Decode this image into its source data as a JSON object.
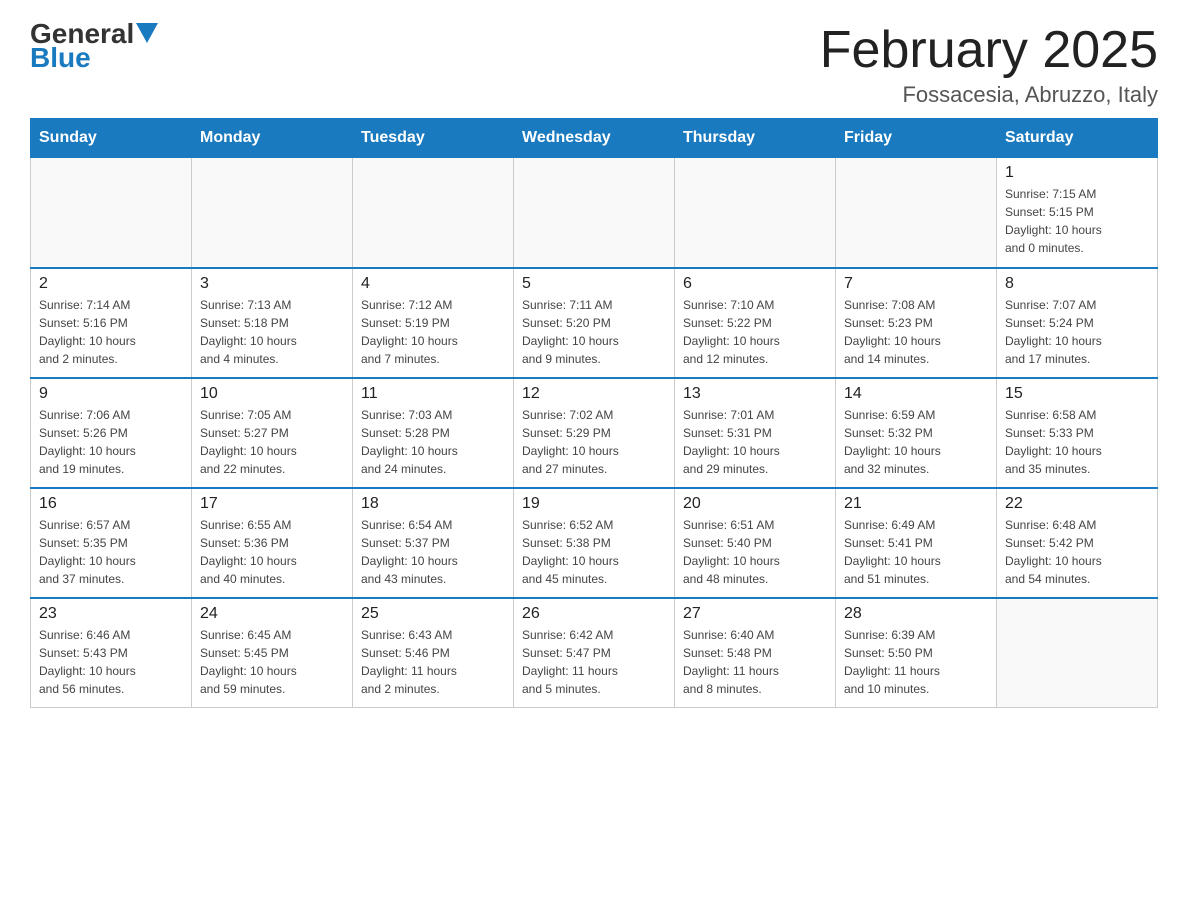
{
  "header": {
    "logo": {
      "general": "General",
      "blue": "Blue"
    },
    "title": "February 2025",
    "location": "Fossacesia, Abruzzo, Italy"
  },
  "days_of_week": [
    "Sunday",
    "Monday",
    "Tuesday",
    "Wednesday",
    "Thursday",
    "Friday",
    "Saturday"
  ],
  "weeks": [
    [
      {
        "day": "",
        "info": ""
      },
      {
        "day": "",
        "info": ""
      },
      {
        "day": "",
        "info": ""
      },
      {
        "day": "",
        "info": ""
      },
      {
        "day": "",
        "info": ""
      },
      {
        "day": "",
        "info": ""
      },
      {
        "day": "1",
        "info": "Sunrise: 7:15 AM\nSunset: 5:15 PM\nDaylight: 10 hours\nand 0 minutes."
      }
    ],
    [
      {
        "day": "2",
        "info": "Sunrise: 7:14 AM\nSunset: 5:16 PM\nDaylight: 10 hours\nand 2 minutes."
      },
      {
        "day": "3",
        "info": "Sunrise: 7:13 AM\nSunset: 5:18 PM\nDaylight: 10 hours\nand 4 minutes."
      },
      {
        "day": "4",
        "info": "Sunrise: 7:12 AM\nSunset: 5:19 PM\nDaylight: 10 hours\nand 7 minutes."
      },
      {
        "day": "5",
        "info": "Sunrise: 7:11 AM\nSunset: 5:20 PM\nDaylight: 10 hours\nand 9 minutes."
      },
      {
        "day": "6",
        "info": "Sunrise: 7:10 AM\nSunset: 5:22 PM\nDaylight: 10 hours\nand 12 minutes."
      },
      {
        "day": "7",
        "info": "Sunrise: 7:08 AM\nSunset: 5:23 PM\nDaylight: 10 hours\nand 14 minutes."
      },
      {
        "day": "8",
        "info": "Sunrise: 7:07 AM\nSunset: 5:24 PM\nDaylight: 10 hours\nand 17 minutes."
      }
    ],
    [
      {
        "day": "9",
        "info": "Sunrise: 7:06 AM\nSunset: 5:26 PM\nDaylight: 10 hours\nand 19 minutes."
      },
      {
        "day": "10",
        "info": "Sunrise: 7:05 AM\nSunset: 5:27 PM\nDaylight: 10 hours\nand 22 minutes."
      },
      {
        "day": "11",
        "info": "Sunrise: 7:03 AM\nSunset: 5:28 PM\nDaylight: 10 hours\nand 24 minutes."
      },
      {
        "day": "12",
        "info": "Sunrise: 7:02 AM\nSunset: 5:29 PM\nDaylight: 10 hours\nand 27 minutes."
      },
      {
        "day": "13",
        "info": "Sunrise: 7:01 AM\nSunset: 5:31 PM\nDaylight: 10 hours\nand 29 minutes."
      },
      {
        "day": "14",
        "info": "Sunrise: 6:59 AM\nSunset: 5:32 PM\nDaylight: 10 hours\nand 32 minutes."
      },
      {
        "day": "15",
        "info": "Sunrise: 6:58 AM\nSunset: 5:33 PM\nDaylight: 10 hours\nand 35 minutes."
      }
    ],
    [
      {
        "day": "16",
        "info": "Sunrise: 6:57 AM\nSunset: 5:35 PM\nDaylight: 10 hours\nand 37 minutes."
      },
      {
        "day": "17",
        "info": "Sunrise: 6:55 AM\nSunset: 5:36 PM\nDaylight: 10 hours\nand 40 minutes."
      },
      {
        "day": "18",
        "info": "Sunrise: 6:54 AM\nSunset: 5:37 PM\nDaylight: 10 hours\nand 43 minutes."
      },
      {
        "day": "19",
        "info": "Sunrise: 6:52 AM\nSunset: 5:38 PM\nDaylight: 10 hours\nand 45 minutes."
      },
      {
        "day": "20",
        "info": "Sunrise: 6:51 AM\nSunset: 5:40 PM\nDaylight: 10 hours\nand 48 minutes."
      },
      {
        "day": "21",
        "info": "Sunrise: 6:49 AM\nSunset: 5:41 PM\nDaylight: 10 hours\nand 51 minutes."
      },
      {
        "day": "22",
        "info": "Sunrise: 6:48 AM\nSunset: 5:42 PM\nDaylight: 10 hours\nand 54 minutes."
      }
    ],
    [
      {
        "day": "23",
        "info": "Sunrise: 6:46 AM\nSunset: 5:43 PM\nDaylight: 10 hours\nand 56 minutes."
      },
      {
        "day": "24",
        "info": "Sunrise: 6:45 AM\nSunset: 5:45 PM\nDaylight: 10 hours\nand 59 minutes."
      },
      {
        "day": "25",
        "info": "Sunrise: 6:43 AM\nSunset: 5:46 PM\nDaylight: 11 hours\nand 2 minutes."
      },
      {
        "day": "26",
        "info": "Sunrise: 6:42 AM\nSunset: 5:47 PM\nDaylight: 11 hours\nand 5 minutes."
      },
      {
        "day": "27",
        "info": "Sunrise: 6:40 AM\nSunset: 5:48 PM\nDaylight: 11 hours\nand 8 minutes."
      },
      {
        "day": "28",
        "info": "Sunrise: 6:39 AM\nSunset: 5:50 PM\nDaylight: 11 hours\nand 10 minutes."
      },
      {
        "day": "",
        "info": ""
      }
    ]
  ]
}
